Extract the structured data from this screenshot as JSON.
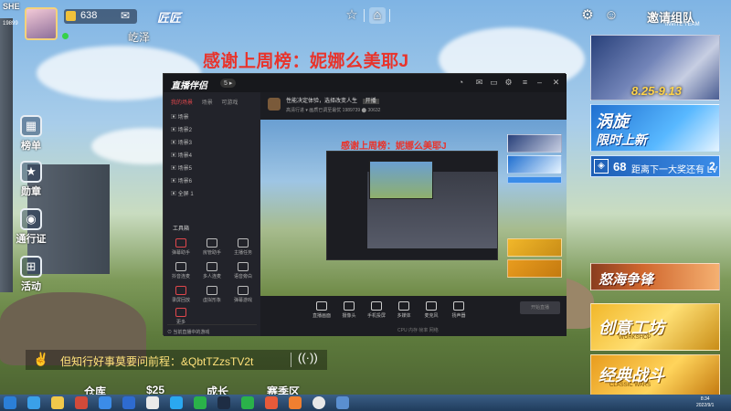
{
  "hud": {
    "avatar_tag": "SHE",
    "avatar_number": "19899",
    "coins": "638",
    "player_name": "屹泽",
    "brand": "匠匠",
    "invite_label": "邀请组队",
    "invite_sub": "INVITE TEAM"
  },
  "side_menu": [
    {
      "icon": "ranking-icon",
      "glyph": "▦",
      "label": "榜单"
    },
    {
      "icon": "star-icon",
      "glyph": "★",
      "label": "勋章"
    },
    {
      "icon": "pass-icon",
      "glyph": "◉",
      "label": "通行证"
    },
    {
      "icon": "gift-icon",
      "glyph": "⊞",
      "label": "活动"
    }
  ],
  "stream_title": "感谢上周榜：妮娜么美耶J",
  "banners": {
    "b1_date": "8.25-9.13",
    "b2_line1": "涡旋",
    "b2_line2": "限时上新",
    "level_num": "68",
    "level_text": "距离下一大奖还有 LV",
    "level_val": "2",
    "b3_text": "怒海争锋",
    "b4_text": "创意工坊",
    "b4_sub": "WORKSHOP",
    "b5_text": "经典战斗",
    "b5_sub": "CLASSIC WARS"
  },
  "chat": {
    "icon": "✌",
    "message": "但知行好事莫要问前程：&QbtTZzsTV2t",
    "voice_icon": "((·))"
  },
  "bottom_nav": [
    "仓库",
    "$25",
    "成长",
    "赛季区"
  ],
  "streaming_app": {
    "logo": "直播伴侣",
    "badge": "5 ▸",
    "tabs": [
      "我的场景",
      "场景",
      "可游戏"
    ],
    "scene_rows": [
      "▣ 场景",
      "▣ 场景2",
      "▣ 场景3",
      "▣ 场景4",
      "▣ 场景5",
      "▣ 场景6",
      "▣ 全屏 1"
    ],
    "tools_title": "工具箱",
    "tools": [
      {
        "label": "弹幕助手",
        "red": true
      },
      {
        "label": "房管助手",
        "red": false
      },
      {
        "label": "主播任务",
        "red": false
      },
      {
        "label": "抖音连麦",
        "red": false
      },
      {
        "label": "多人连麦",
        "red": false
      },
      {
        "label": "语音旁白",
        "red": false
      },
      {
        "label": "录屏回放",
        "red": true
      },
      {
        "label": "虚拟形象",
        "red": false
      },
      {
        "label": "弹幕游戏",
        "red": false
      },
      {
        "label": "更多",
        "red": true
      }
    ],
    "footer": "⊙ 当前直播中的游戏",
    "header_title": "性能决定体验，选择改变人生",
    "header_tag": "开播",
    "header_sub": "高清行进 ▾  画质已调至最优  1989739  ⬤ 30632",
    "preview_title": "感谢上周榜：妮娜么美耶J",
    "toolbar": [
      "直播画面",
      "摄像头",
      "手机投屏",
      "多媒体",
      "麦克风",
      "扬声器"
    ],
    "start_label": "开始直播",
    "stats": "CPU  内存  帧率  网络"
  },
  "taskbar": {
    "time": "8:34",
    "date": "2022/9/1"
  }
}
